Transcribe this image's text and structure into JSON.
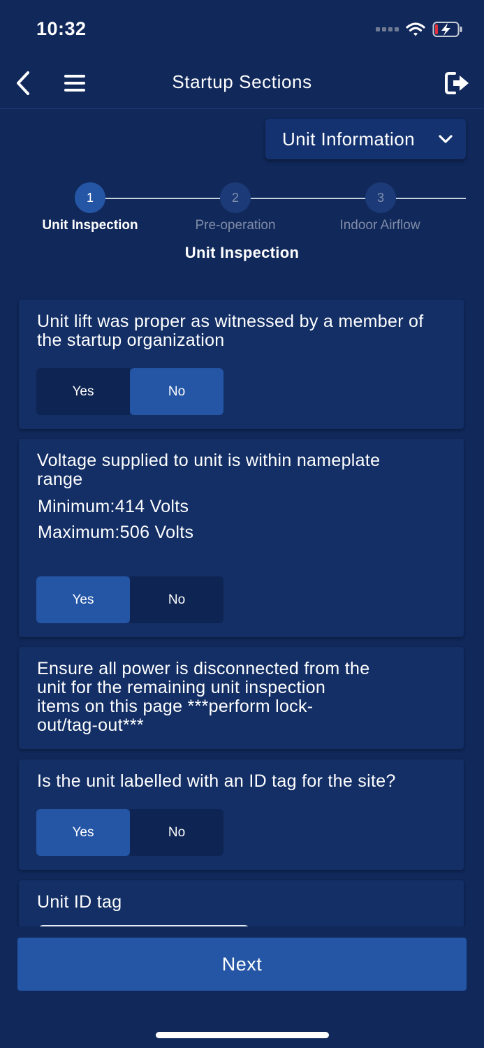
{
  "status_bar": {
    "time": "10:32",
    "icons": [
      "signal-dots-icon",
      "wifi-icon",
      "battery-charging-icon"
    ]
  },
  "nav": {
    "title": "Startup Sections",
    "back_icon": "chevron-left-icon",
    "menu_icon": "hamburger-menu-icon",
    "logout_icon": "logout-icon"
  },
  "section_dropdown": {
    "selected": "Unit Information"
  },
  "stepper": {
    "steps": [
      {
        "number": "1",
        "label": "Unit Inspection",
        "active": true
      },
      {
        "number": "2",
        "label": "Pre-operation",
        "active": false
      },
      {
        "number": "3",
        "label": "Indoor Airflow",
        "active": false
      }
    ],
    "current_title": "Unit Inspection"
  },
  "questions": [
    {
      "text": "Unit lift was proper as witnessed by a member of the startup organization",
      "options": [
        "Yes",
        "No"
      ],
      "selected": "No"
    },
    {
      "text": "Voltage supplied to unit is within nameplate range",
      "minimum": "Minimum:414 Volts",
      "maximum": "Maximum:506 Volts",
      "options": [
        "Yes",
        "No"
      ],
      "selected": "Yes"
    },
    {
      "text": "Ensure all power is disconnected from the unit for the remaining unit inspection items on this page ***perform lock-out/tag-out***"
    },
    {
      "text": "Is the unit labelled with an ID tag for the site?",
      "options": [
        "Yes",
        "No"
      ],
      "selected": "Yes"
    },
    {
      "text": "Unit ID tag",
      "value": ""
    }
  ],
  "footer": {
    "next_label": "Next"
  },
  "colors": {
    "background": "#10285a",
    "card": "#132f66",
    "accent": "#2456a5",
    "unselected": "#0e2452"
  }
}
